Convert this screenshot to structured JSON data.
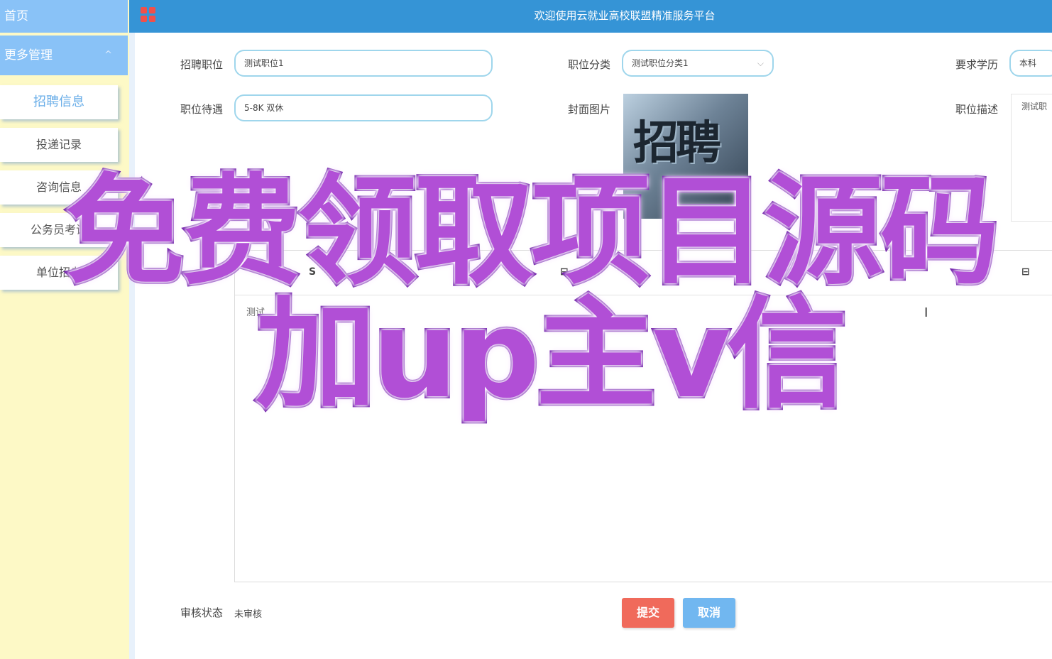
{
  "sidebar": {
    "home_label": "首页",
    "more_label": "更多管理",
    "more_caret": "^",
    "items": [
      {
        "label": "招聘信息"
      },
      {
        "label": "投递记录"
      },
      {
        "label": "咨询信息"
      },
      {
        "label": "公务员考试"
      },
      {
        "label": "单位招考"
      }
    ]
  },
  "header": {
    "title": "欢迎使用云就业高校联盟精准服务平台",
    "menu_icon": "grid-icon",
    "menu_icon_color": "#f0504a",
    "bg_color": "#3594d6"
  },
  "form": {
    "position": {
      "label": "招聘职位",
      "value": "测试职位1"
    },
    "category": {
      "label": "职位分类",
      "value": "测试职位分类1",
      "chevron": "⌵"
    },
    "education": {
      "label": "要求学历",
      "value": "本科"
    },
    "salary": {
      "label": "职位待遇",
      "value": "5-8K 双休"
    },
    "cover": {
      "label": "封面图片",
      "image_text": "招聘"
    },
    "description": {
      "label": "职位描述",
      "value": "测试职"
    },
    "editor": {
      "toolbar_left": "S",
      "toolbar_mid": "⊟",
      "toolbar_right": "⊟",
      "content": "测试..."
    },
    "review": {
      "label": "审核状态",
      "value": "未审核"
    }
  },
  "buttons": {
    "submit_label": "提交",
    "submit_color": "#f06a5b",
    "cancel_label": "取消",
    "cancel_color": "#71b7f0"
  },
  "promo": {
    "line1": "免费领取项目源码",
    "line2": "加up主v信"
  }
}
